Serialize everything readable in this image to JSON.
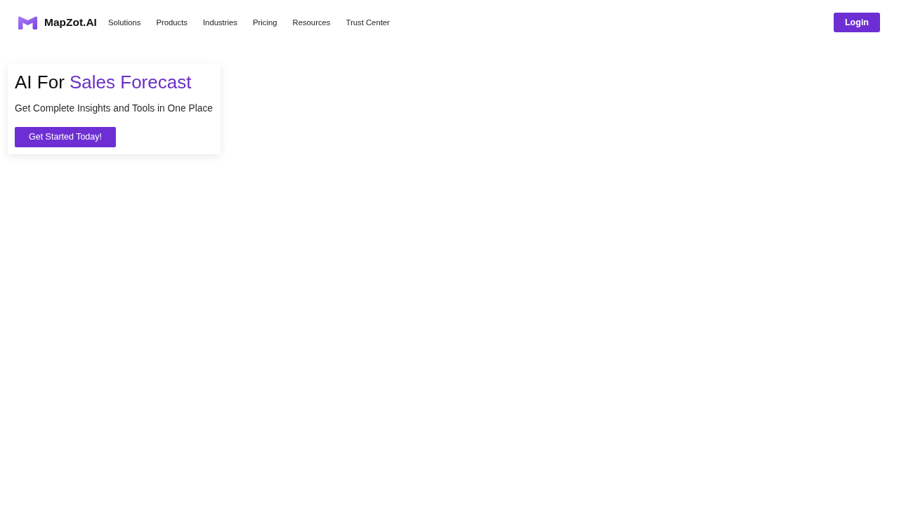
{
  "navbar": {
    "brand": "MapZot.AI",
    "links": [
      "Solutions",
      "Products",
      "Industries",
      "Pricing",
      "Resources",
      "Trust Center"
    ],
    "login_button": "Login"
  },
  "hero": {
    "heading": {
      "text": "AI For",
      "highlight": "Sales Forecast"
    },
    "subtitle": "Get Complete Insights and Tools in One Place",
    "cta_button": "Get Started Today!"
  }
}
